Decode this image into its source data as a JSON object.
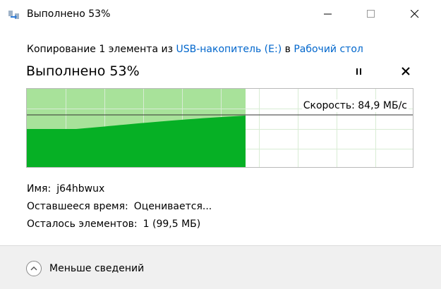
{
  "window": {
    "title": "Выполнено 53%",
    "icon": "copy-arrow-icon"
  },
  "copy_info": {
    "prefix": "Копирование 1 элемента из ",
    "source": "USB-накопитель (E:)",
    "middle": " в ",
    "destination": "Рабочий стол"
  },
  "progress": {
    "title": "Выполнено 53%",
    "percent": 53,
    "speed_text": "Скорость: 84,9 МБ/с"
  },
  "details": {
    "name_label": "Имя:",
    "name_value": "j64hbwux",
    "time_label": "Оставшееся время:",
    "time_value": "Оценивается...",
    "items_label": "Осталось элементов:",
    "items_value": "1 (99,5 МБ)"
  },
  "footer": {
    "less_details_label": "Меньше сведений"
  },
  "colors": {
    "progress_fill": "#a8e29a",
    "speed_fill": "#06b025",
    "grid": "#d8ecd4",
    "link": "#0066cc"
  }
}
